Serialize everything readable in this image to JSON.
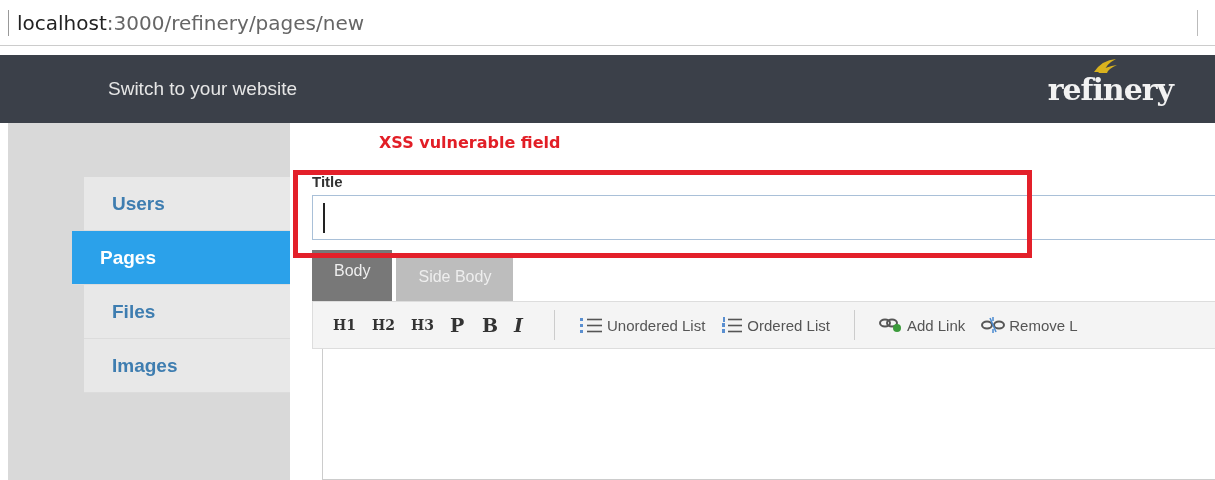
{
  "address_bar": {
    "url": "**localhost**:3000/refinery/pages/new"
  },
  "header": {
    "switch_link": "Switch to your website",
    "logo": "refinery"
  },
  "sidebar": {
    "items": [
      {
        "label": "Users",
        "selected": false
      },
      {
        "label": "Pages",
        "selected": true
      },
      {
        "label": "Files",
        "selected": false
      },
      {
        "label": "Images",
        "selected": false
      }
    ]
  },
  "annotation": {
    "label": "XSS vulnerable field"
  },
  "title_field": {
    "label": "Title",
    "focused": true
  },
  "tabs": [
    {
      "label": "Body",
      "selected": true
    },
    {
      "label": "Side Body",
      "selected": false
    }
  ],
  "toolbar": {
    "groups": [
      [
        {
          "kind": "format",
          "label": "H1"
        },
        {
          "kind": "format",
          "label": "H2"
        },
        {
          "kind": "format",
          "label": "H3"
        },
        {
          "kind": "format",
          "label": "P"
        },
        {
          "kind": "format",
          "label": "B"
        },
        {
          "kind": "italic",
          "label": "I"
        }
      ],
      [
        {
          "kind": "unordered",
          "label": "Unordered List"
        },
        {
          "kind": "ordered",
          "label": "Ordered List"
        }
      ],
      [
        {
          "kind": "link",
          "label": "Add Link"
        },
        {
          "kind": "unlink",
          "label": "Remove L"
        }
      ]
    ]
  }
}
